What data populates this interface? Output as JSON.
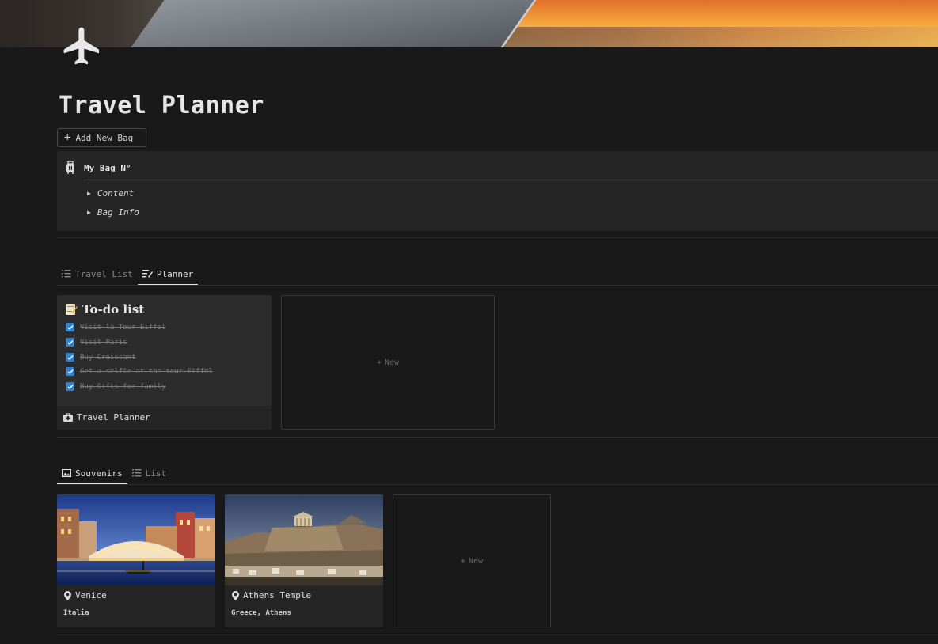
{
  "page": {
    "title": "Travel Planner",
    "icon": "airplane-icon"
  },
  "toolbar": {
    "add_bag_label": "Add New Bag"
  },
  "bag": {
    "title": "My Bag N°",
    "toggles": [
      "Content",
      "Bag Info"
    ]
  },
  "planner_tabs": [
    {
      "label": "Travel List",
      "icon": "list-icon",
      "active": false
    },
    {
      "label": "Planner",
      "icon": "edit-list-icon",
      "active": true
    }
  ],
  "todo_card": {
    "title": "To-do list",
    "emoji": "memo-icon",
    "items": [
      "Visit la Tour Eiffel",
      "Visit Paris",
      "Buy Croissant",
      "Get a selfie at the tour Eiffel",
      "Buy Gifts for family"
    ],
    "footer": "Travel Planner"
  },
  "new_label": "New",
  "souvenir_tabs": [
    {
      "label": "Souvenirs",
      "icon": "gallery-icon",
      "active": true
    },
    {
      "label": "List",
      "icon": "list-icon",
      "active": false
    }
  ],
  "souvenirs": [
    {
      "name": "Venice",
      "tag": "Italia"
    },
    {
      "name": "Athens Temple",
      "tag": "Greece, Athens"
    }
  ],
  "colors": {
    "background": "#191919",
    "checkbox": "#2e82d4"
  }
}
